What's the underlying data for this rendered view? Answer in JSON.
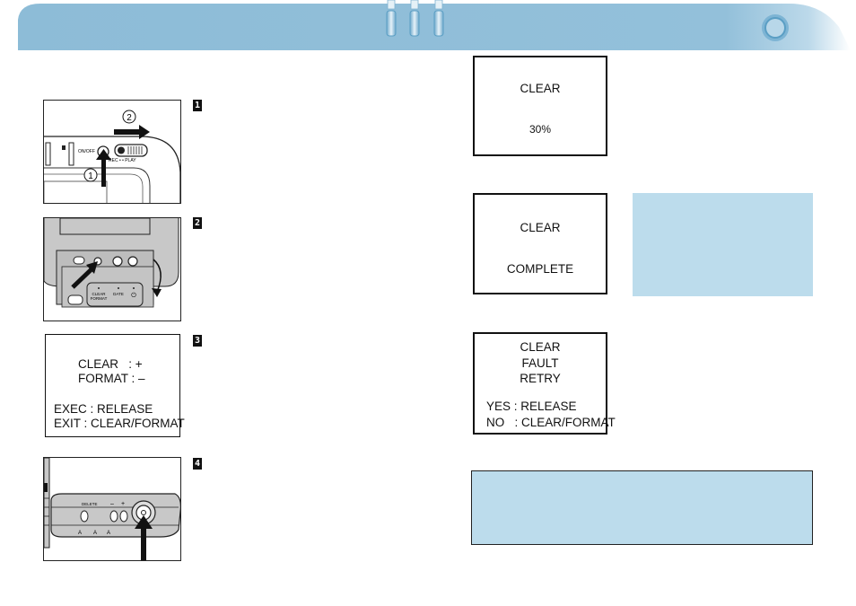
{
  "header": {
    "colors": {
      "banner": "#8fbdd8",
      "banner_light": "#bcdcec",
      "accent": "#5a9ec4"
    },
    "icons": [
      "binder-ring-icon",
      "binder-ring-icon",
      "binder-ring-icon",
      "ring-hole-icon"
    ]
  },
  "steps": [
    {
      "number": "1",
      "illustration": "power-on-slide-mode",
      "labels": {
        "callout_1": "1",
        "callout_2": "2",
        "onoff": "ON/OFF",
        "mode": "REC • • PLAY"
      }
    },
    {
      "number": "2",
      "illustration": "press-clear-format-button",
      "labels": {
        "clear": "CLEAR",
        "format": "FORMAT",
        "date": "DATE",
        "power": "⏻"
      }
    },
    {
      "number": "3",
      "screen": {
        "lines": [
          "CLEAR   : +",
          "FORMAT : –",
          "EXEC : RELEASE",
          "EXIT : CLEAR/FORMAT"
        ]
      }
    },
    {
      "number": "4",
      "illustration": "press-release-button",
      "labels": {
        "delete": "DELETE",
        "minus": "–",
        "plus": "+"
      }
    }
  ],
  "screens": {
    "progress": {
      "title": "CLEAR",
      "value": "30%"
    },
    "complete": {
      "title": "CLEAR",
      "status": "COMPLETE"
    },
    "fault": {
      "lines": [
        "CLEAR",
        "FAULT",
        "RETRY"
      ],
      "yes": "YES : RELEASE",
      "no": "NO   : CLEAR/FORMAT"
    }
  },
  "notes": {
    "side_note_color": "#bcdcec",
    "bottom_note_color": "#bcdcec"
  }
}
